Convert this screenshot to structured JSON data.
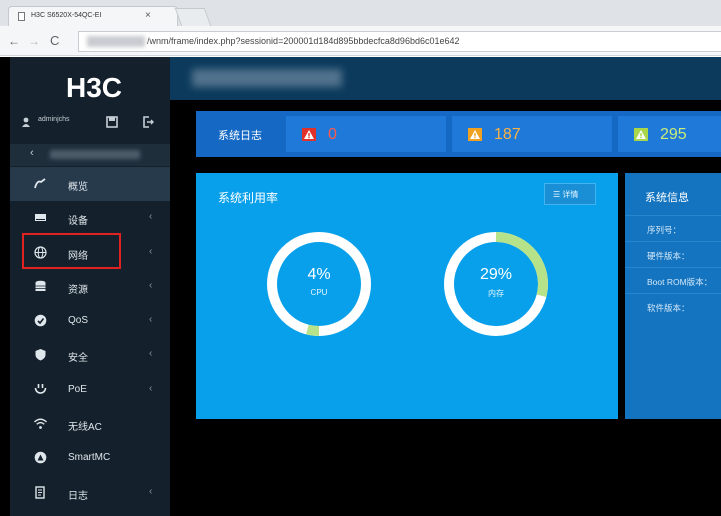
{
  "browser": {
    "tab_title": "H3C S6520X-54QC-EI",
    "url": "/wnm/frame/index.php?sessionid=200001d184d895bbdecfca8d96bd6c01e642"
  },
  "sidebar": {
    "brand": "H3C",
    "username": "adminjchs",
    "items": [
      {
        "label": "概览",
        "icon": "overview-icon",
        "active": true,
        "arrow": false
      },
      {
        "label": "设备",
        "icon": "device-icon",
        "active": false,
        "arrow": true
      },
      {
        "label": "网络",
        "icon": "globe-icon",
        "active": false,
        "arrow": true
      },
      {
        "label": "资源",
        "icon": "resource-icon",
        "active": false,
        "arrow": true
      },
      {
        "label": "QoS",
        "icon": "qos-icon",
        "active": false,
        "arrow": true
      },
      {
        "label": "安全",
        "icon": "shield-icon",
        "active": false,
        "arrow": true
      },
      {
        "label": "PoE",
        "icon": "poe-icon",
        "active": false,
        "arrow": true
      },
      {
        "label": "无线AC",
        "icon": "wifi-icon",
        "active": false,
        "arrow": false
      },
      {
        "label": "SmartMC",
        "icon": "smartmc-icon",
        "active": false,
        "arrow": false
      },
      {
        "label": "日志",
        "icon": "log-icon",
        "active": false,
        "arrow": true
      }
    ]
  },
  "syslog": {
    "title": "系统日志",
    "levels": [
      {
        "count": "0",
        "color": "#e0312b",
        "text_color": "#ff5a4e"
      },
      {
        "count": "187",
        "color": "#f0a120",
        "text_color": "#f7b245"
      },
      {
        "count": "295",
        "color": "#a8d84a",
        "text_color": "#c9ec7a"
      }
    ]
  },
  "utilization": {
    "title": "系统利用率",
    "detail_label": "详情",
    "gauges": [
      {
        "label": "CPU",
        "percent": 4,
        "value_text": "4%"
      },
      {
        "label": "内存",
        "percent": 29,
        "value_text": "29%"
      }
    ]
  },
  "sysinfo": {
    "title": "系统信息",
    "rows": [
      "序列号：",
      "硬件版本：",
      "Boot ROM版本：",
      "软件版本："
    ]
  },
  "colors": {
    "accent": "#08a0ea",
    "gauge_fill": "#b6e38a",
    "highlight": "#e02222"
  }
}
